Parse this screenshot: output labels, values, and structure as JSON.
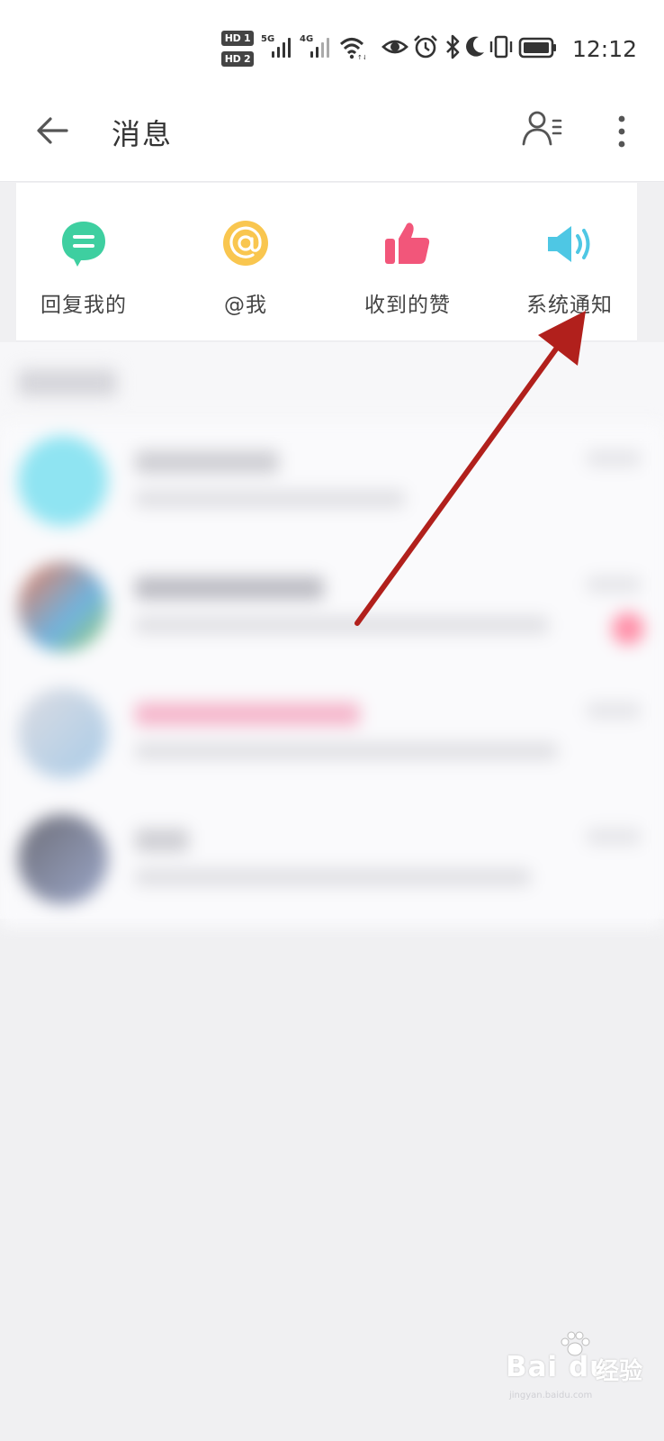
{
  "status_bar": {
    "hd1": "HD 1",
    "hd2": "HD 2",
    "net1": "5G",
    "net2": "4G",
    "time": "12:12",
    "icons": [
      "wifi-icon",
      "eye-icon",
      "alarm-icon",
      "bluetooth-icon",
      "moon-icon",
      "vibrate-icon",
      "battery-icon"
    ]
  },
  "header": {
    "title": "消息",
    "icons": [
      "back-arrow-icon",
      "contacts-icon",
      "more-vertical-icon"
    ]
  },
  "shortcuts": [
    {
      "label": "回复我的",
      "icon": "reply-bubble-icon",
      "color": "#3ecfa0"
    },
    {
      "label": "@我",
      "icon": "at-icon",
      "color": "#f9c64f"
    },
    {
      "label": "收到的赞",
      "icon": "thumbs-up-icon",
      "color": "#f2567a"
    },
    {
      "label": "系统通知",
      "icon": "speaker-icon",
      "color": "#4ec7e4"
    }
  ],
  "annotation": {
    "color": "#b1201c",
    "target": "系统通知"
  },
  "watermark": {
    "brand": "Bai du",
    "brand_cn": "经验",
    "url": "jingyan.baidu.com"
  }
}
